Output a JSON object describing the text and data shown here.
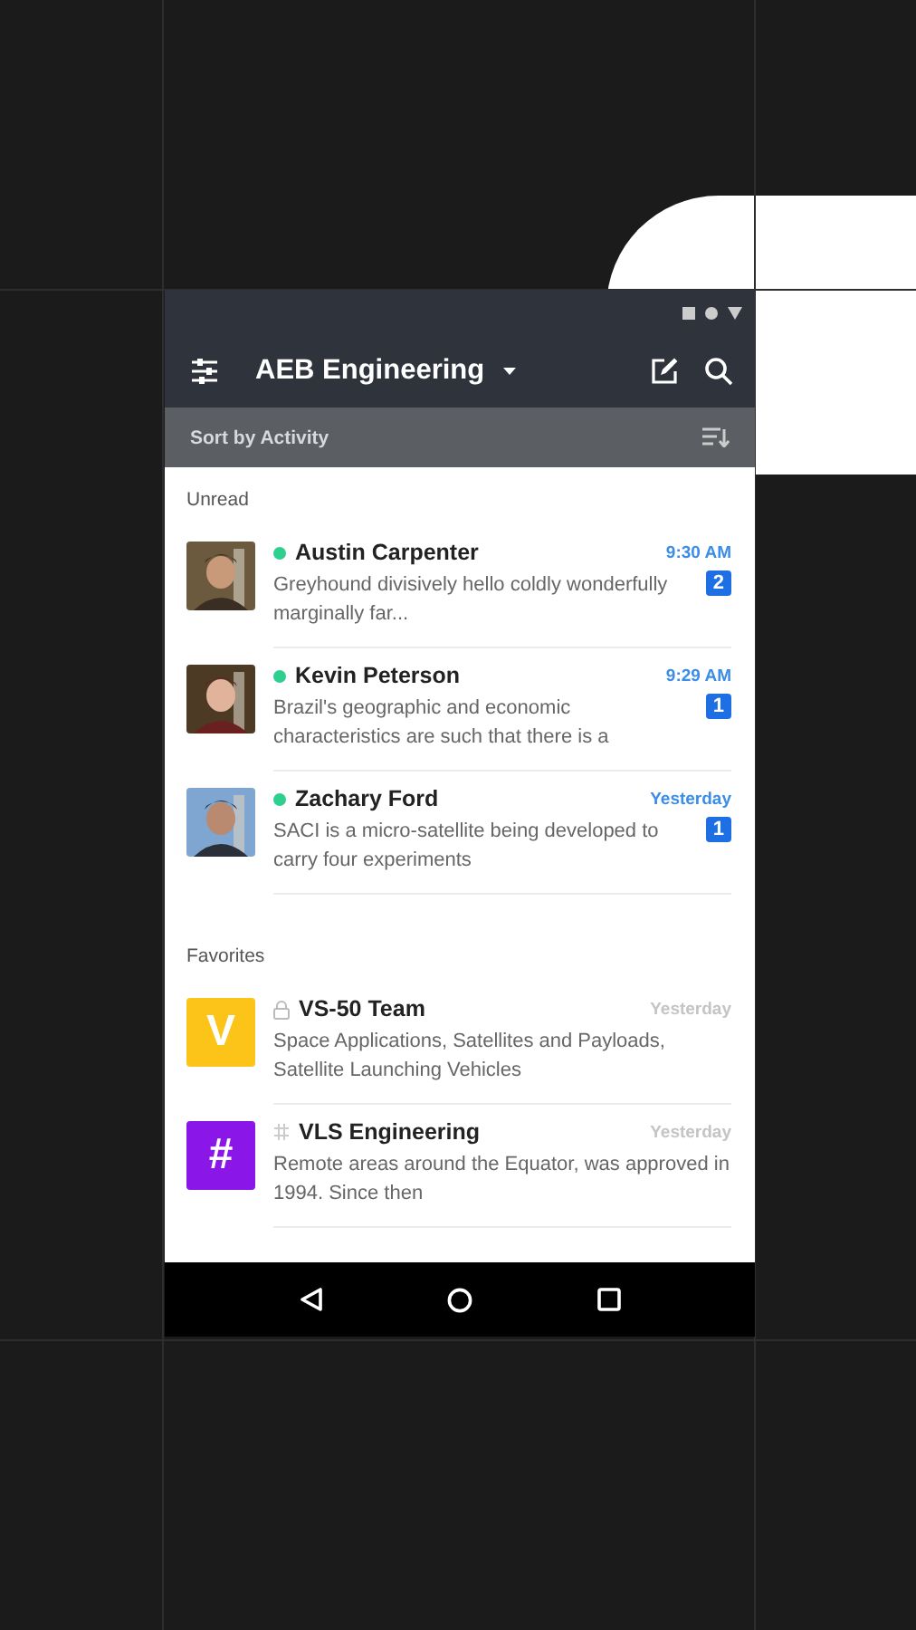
{
  "app_bar": {
    "title": "AEB Engineering"
  },
  "sort_bar": {
    "label": "Sort by Activity"
  },
  "sections": [
    {
      "title": "Unread",
      "items": [
        {
          "kind": "person",
          "name": "Austin Carpenter",
          "online": true,
          "preview": "Greyhound divisively hello coldly wonderfully marginally far...",
          "time": "9:30 AM",
          "unread": true,
          "badge": "2"
        },
        {
          "kind": "person",
          "name": "Kevin Peterson",
          "online": true,
          "preview": "Brazil's geographic and economic characteristics are such that there is a",
          "time": "9:29 AM",
          "unread": true,
          "badge": "1"
        },
        {
          "kind": "person",
          "name": "Zachary Ford",
          "online": true,
          "preview": "SACI is a micro-satellite being developed to carry four experiments",
          "time": "Yesterday",
          "unread": true,
          "badge": "1"
        }
      ]
    },
    {
      "title": "Favorites",
      "items": [
        {
          "kind": "private",
          "name": "VS-50 Team",
          "initial": "V",
          "color": "#fcc419",
          "preview": "Space Applications, Satellites and Payloads, Satellite Launching Vehicles",
          "time": "Yesterday",
          "unread": false
        },
        {
          "kind": "public",
          "name": "VLS Engineering",
          "initial": "#",
          "color": "#8a16e8",
          "preview": "Remote areas around the Equator, was approved in 1994. Since then",
          "time": "Yesterday",
          "unread": false
        }
      ]
    }
  ]
}
